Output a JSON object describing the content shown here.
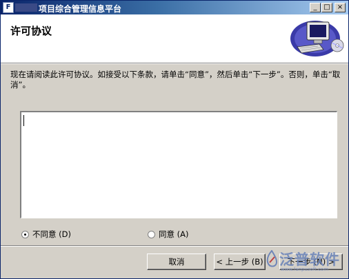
{
  "titlebar": {
    "title": "项目综合管理信息平台",
    "app_icon_glyph": "F",
    "controls": {
      "minimize": "_",
      "maximize": "□",
      "close": "×"
    }
  },
  "header": {
    "title": "许可协议"
  },
  "instructions": "现在请阅读此许可协议。如接受以下条款，请单击“同意”，然后单击“下一步”。否则，单击“取消”。",
  "license_text": "",
  "options": {
    "disagree": {
      "label": "不同意 (D)",
      "checked": true
    },
    "agree": {
      "label": "同意 (A)",
      "checked": false
    }
  },
  "buttons": {
    "cancel": "取消",
    "back": "< 上一步 (B)",
    "next": "下一步 (N) >"
  },
  "watermark": {
    "brand": "泛普软件",
    "url": "www.fanpusoft.com"
  },
  "colors": {
    "titlebar_start": "#0a246a",
    "titlebar_end": "#a6caf0",
    "face": "#d4d0c8"
  }
}
